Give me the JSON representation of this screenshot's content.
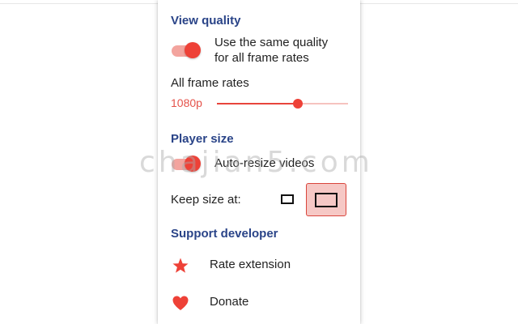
{
  "view_quality": {
    "title": "View quality",
    "same_quality_toggle": {
      "line1": "Use the same quality",
      "line2": "for all frame rates",
      "on": true
    },
    "frame_rates_label": "All frame rates",
    "quality_value": "1080p",
    "quality_level_fraction": 0.62
  },
  "player_size": {
    "title": "Player size",
    "auto_resize_toggle": {
      "label": "Auto-resize videos",
      "on": true
    },
    "keep_size_label": "Keep size at:",
    "selected_size": "large"
  },
  "support": {
    "title": "Support developer",
    "rate_label": "Rate extension",
    "rate_icon": "star-icon",
    "donate_label": "Donate",
    "donate_icon": "heart-icon"
  },
  "watermark": "chajian5.com",
  "colors": {
    "accent": "#ee4137",
    "accent_light": "#f3a49e",
    "section_title": "#2a4488",
    "selected_bg": "#f6c8c5"
  }
}
